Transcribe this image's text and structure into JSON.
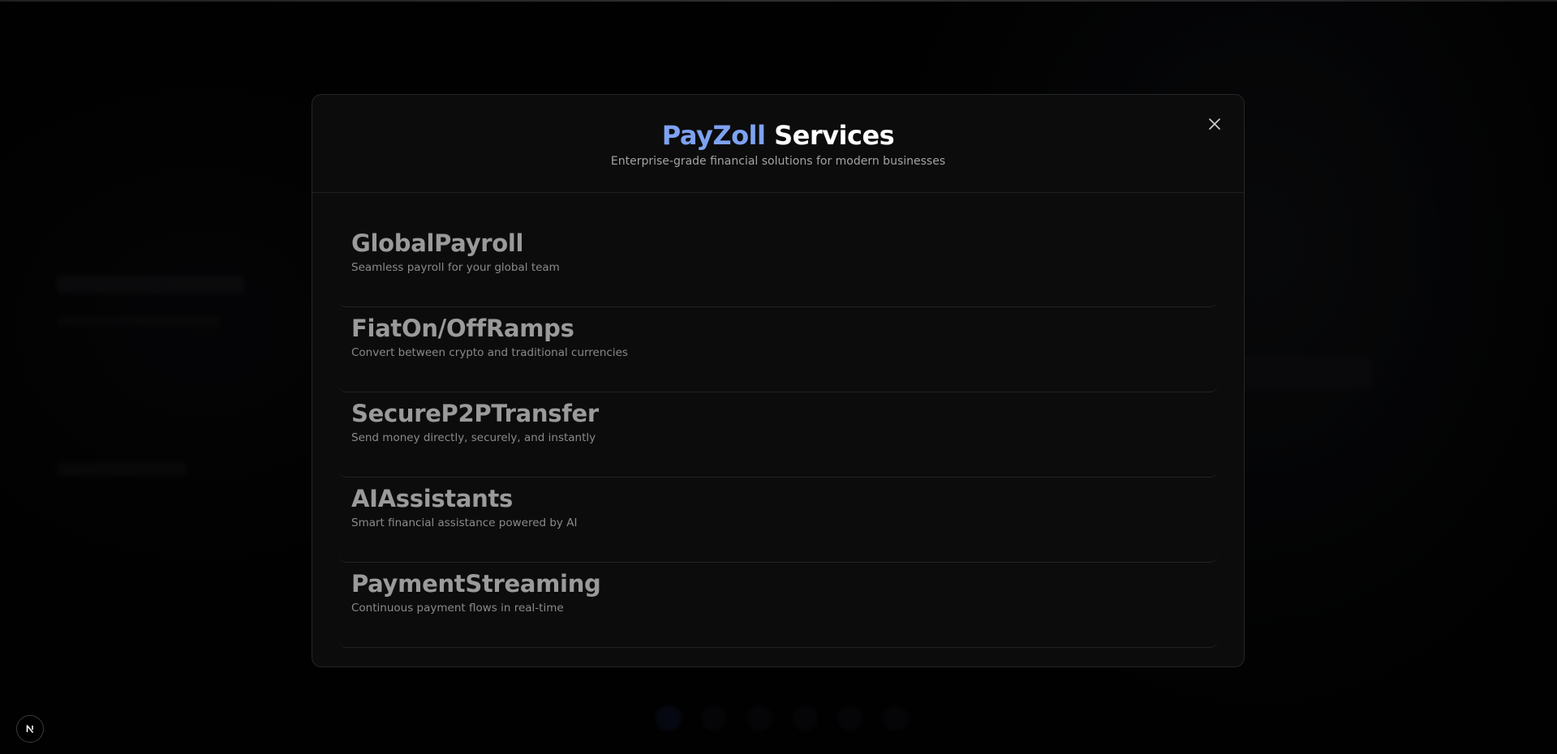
{
  "modal": {
    "title_brand": "PayZoll",
    "title_rest": " Services",
    "subtitle": "Enterprise-grade financial solutions for modern businesses",
    "close_icon": "close-icon"
  },
  "services": [
    {
      "name": "GlobalPayroll",
      "description": "Seamless payroll for your global team"
    },
    {
      "name": "FiatOn/OffRamps",
      "description": "Convert between crypto and traditional currencies"
    },
    {
      "name": "SecureP2PTransfer",
      "description": "Send money directly, securely, and instantly"
    },
    {
      "name": "AIAssistants",
      "description": "Smart financial assistance powered by AI"
    },
    {
      "name": "PaymentStreaming",
      "description": "Continuous payment flows in real-time"
    }
  ],
  "colors": {
    "brand": "#7ea2f2",
    "title": "#ffffff",
    "service_name": "#9a9a9a",
    "service_desc": "#8a8a8a",
    "modal_bg": "#0c0c0c"
  },
  "badge": {
    "icon": "nextjs-logo-icon",
    "letter": "N"
  }
}
